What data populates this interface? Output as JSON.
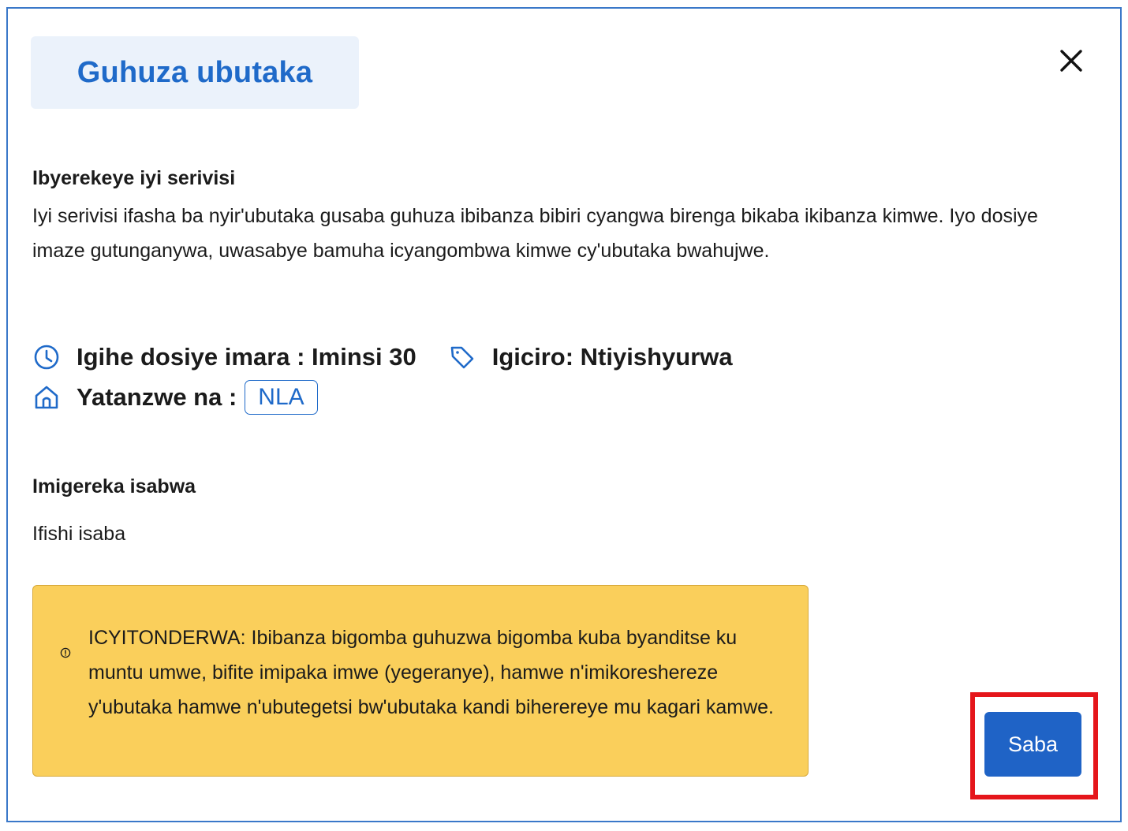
{
  "dialog": {
    "title": "Guhuza ubutaka",
    "close_icon": "close-icon"
  },
  "about": {
    "heading": "Ibyerekeye iyi serivisi",
    "text": "Iyi serivisi ifasha ba nyir'ubutaka gusaba guhuza ibibanza bibiri cyangwa birenga bikaba ikibanza kimwe. Iyo dosiye imaze gutunganywa, uwasabye bamuha icyangombwa kimwe cy'ubutaka bwahujwe."
  },
  "meta": {
    "duration": "Igihe dosiye imara : Iminsi 30",
    "price": "Igiciro: Ntiyishyurwa",
    "provider_label": "Yatanzwe na :",
    "provider_badge": "NLA",
    "icons": [
      "clock-icon",
      "tag-icon",
      "home-icon"
    ]
  },
  "documents": {
    "heading": "Imigereka isabwa",
    "items": [
      "Ifishi isaba"
    ]
  },
  "notice": {
    "icon": "info-icon",
    "text": "ICYITONDERWA: Ibibanza bigomba guhuzwa bigomba kuba byanditse ku muntu umwe, bifite imipaka imwe (yegeranye), hamwe n'imikoreshereze y'ubutaka hamwe n'ubutegetsi bw'ubutaka kandi biherereye mu kagari kamwe."
  },
  "actions": {
    "submit_label": "Saba"
  },
  "colors": {
    "primary": "#1f6ac9",
    "button": "#1f63c6",
    "title_bg": "#ebf2fb",
    "notice_bg": "#facf5b",
    "highlight": "#e5161b",
    "border": "#3a78c9"
  }
}
